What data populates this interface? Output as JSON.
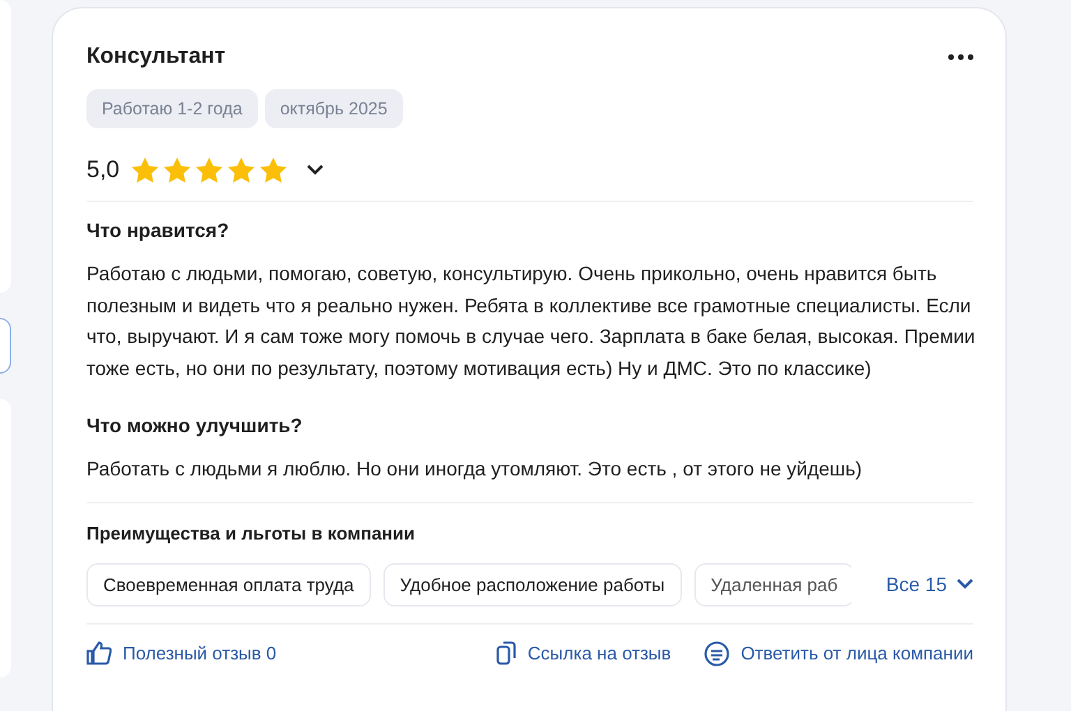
{
  "review": {
    "position": "Консультант",
    "tags": [
      "Работаю 1-2 года",
      "октябрь 2025"
    ],
    "rating": "5,0",
    "stars": 5,
    "sections": [
      {
        "heading": "Что нравится?",
        "text": "Работаю с людьми, помогаю, советую, консультирую. Очень прикольно, очень нравится быть полезным и видеть что я реально нужен. Ребята в коллективе все грамотные специалисты. Если что, выручают. И я сам тоже могу помочь в случае чего. Зарплата в баке белая, высокая. Премии тоже есть, но они по результату, поэтому мотивация есть) Ну и ДМС. Это по классике)"
      },
      {
        "heading": "Что можно улучшить?",
        "text": "Работать с людьми я люблю. Но они иногда утомляют. Это есть , от этого не уйдешь)"
      }
    ],
    "benefits": {
      "title": "Преимущества и льготы в компании",
      "items": [
        "Своевременная оплата труда",
        "Удобное расположение работы",
        "Удаленная раб"
      ],
      "all": "Все 15"
    },
    "footer": {
      "helpful": "Полезный отзыв 0",
      "link": "Ссылка на отзыв",
      "reply": "Ответить от лица компании"
    }
  }
}
